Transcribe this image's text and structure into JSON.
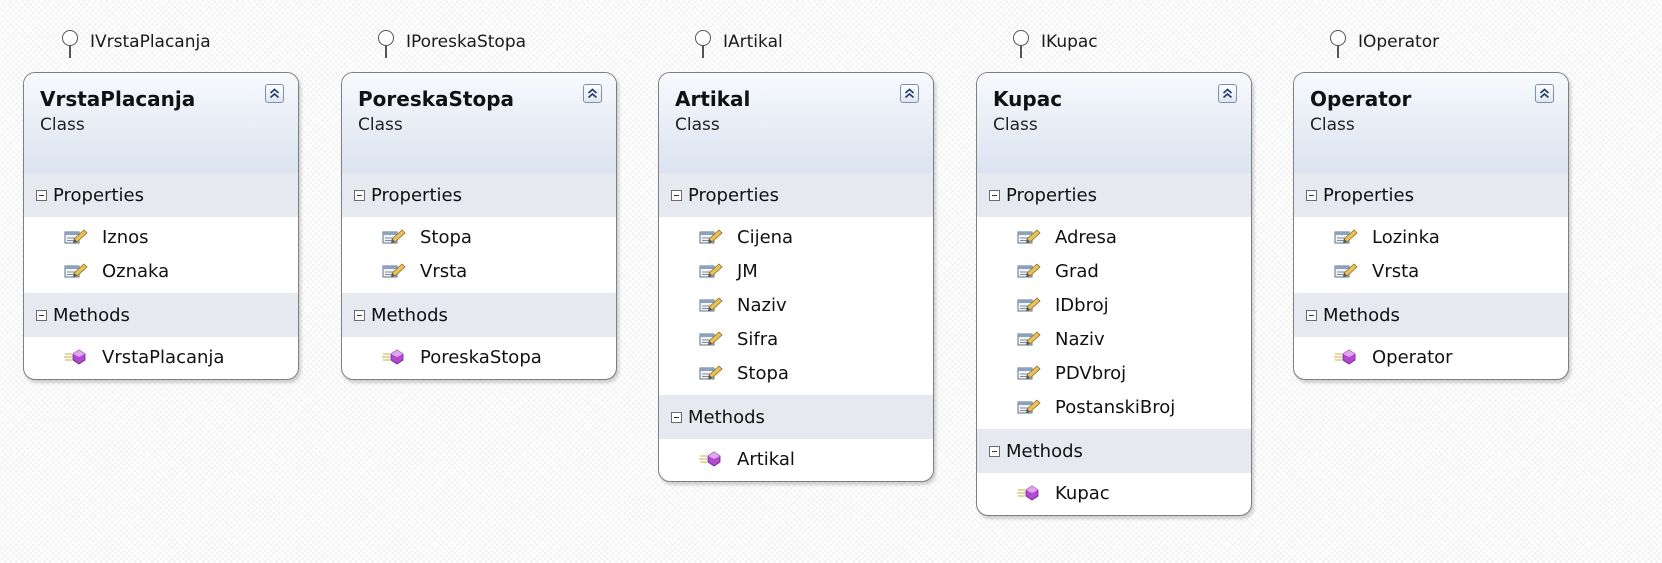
{
  "classes": [
    {
      "interface": "IVrstaPlacanja",
      "name": "VrstaPlacanja",
      "type": "Class",
      "properties_label": "Properties",
      "methods_label": "Methods",
      "properties": [
        "Iznos",
        "Oznaka"
      ],
      "methods": [
        "VrstaPlacanja"
      ]
    },
    {
      "interface": "IPoreskaStopa",
      "name": "PoreskaStopa",
      "type": "Class",
      "properties_label": "Properties",
      "methods_label": "Methods",
      "properties": [
        "Stopa",
        "Vrsta"
      ],
      "methods": [
        "PoreskaStopa"
      ]
    },
    {
      "interface": "IArtikal",
      "name": "Artikal",
      "type": "Class",
      "properties_label": "Properties",
      "methods_label": "Methods",
      "properties": [
        "Cijena",
        "JM",
        "Naziv",
        "Sifra",
        "Stopa"
      ],
      "methods": [
        "Artikal"
      ]
    },
    {
      "interface": "IKupac",
      "name": "Kupac",
      "type": "Class",
      "properties_label": "Properties",
      "methods_label": "Methods",
      "properties": [
        "Adresa",
        "Grad",
        "IDbroj",
        "Naziv",
        "PDVbroj",
        "PostanskiBroj"
      ],
      "methods": [
        "Kupac"
      ]
    },
    {
      "interface": "IOperator",
      "name": "Operator",
      "type": "Class",
      "properties_label": "Properties",
      "methods_label": "Methods",
      "properties": [
        "Lozinka",
        "Vrsta"
      ],
      "methods": [
        "Operator"
      ]
    }
  ],
  "icons": {
    "collapse": "double-chevron-up-icon",
    "section_toggle": "minus-box-icon",
    "property": "property-icon",
    "method": "method-icon"
  },
  "colors": {
    "header_gradient_top": "#f7f9fc",
    "header_gradient_bottom": "#dbe3f1",
    "section_background": "#e6eaf0",
    "method_icon": "#b04ad0"
  }
}
